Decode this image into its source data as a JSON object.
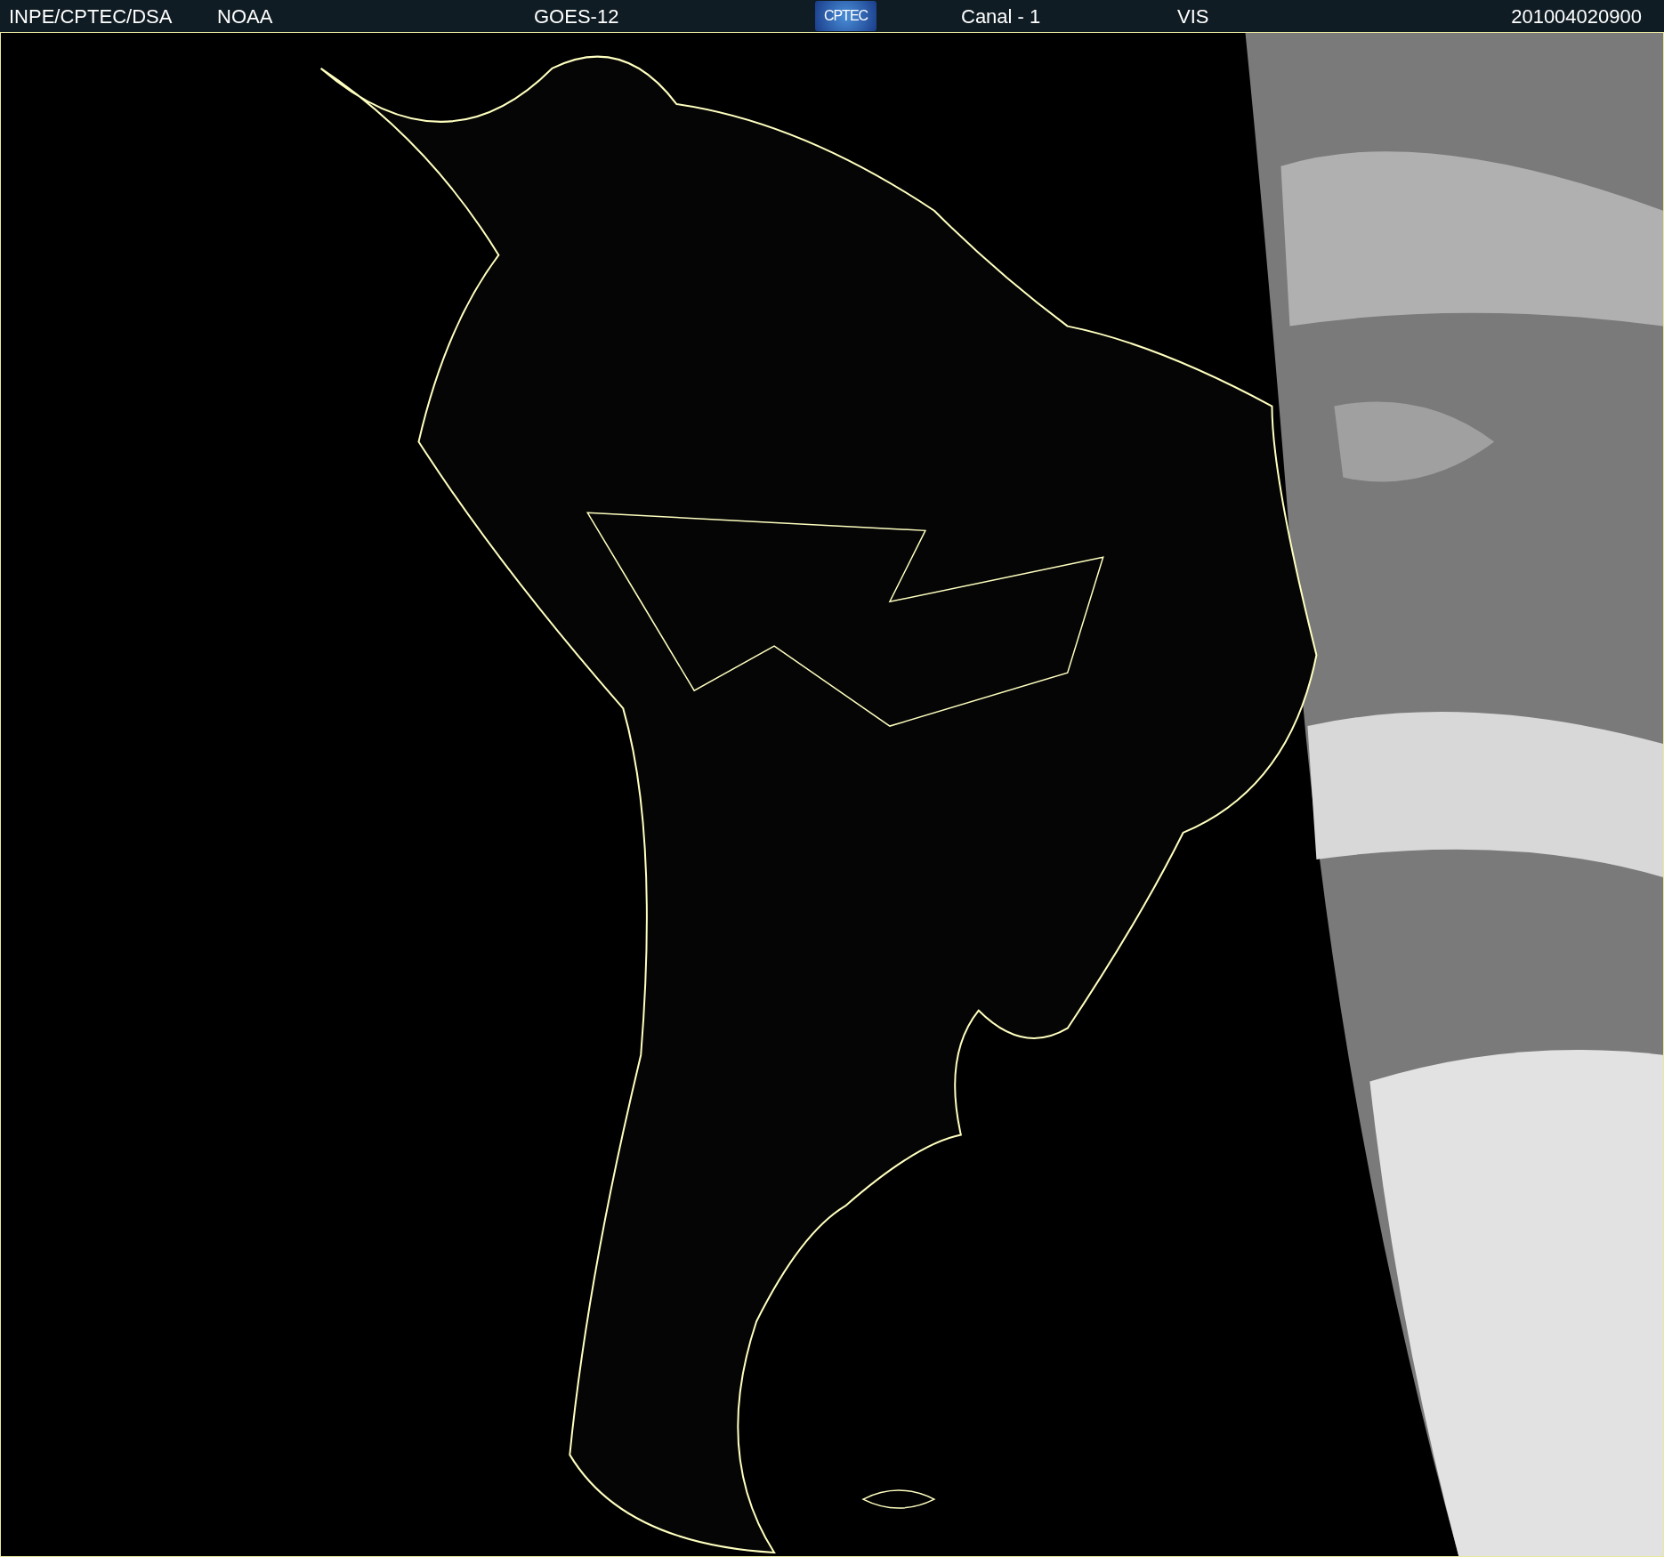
{
  "header": {
    "source": "INPE/CPTEC/DSA",
    "agency": "NOAA",
    "satellite": "GOES-12",
    "logo": "CPTEC",
    "channel": "Canal - 1",
    "band": "VIS",
    "timestamp": "201004020900"
  }
}
